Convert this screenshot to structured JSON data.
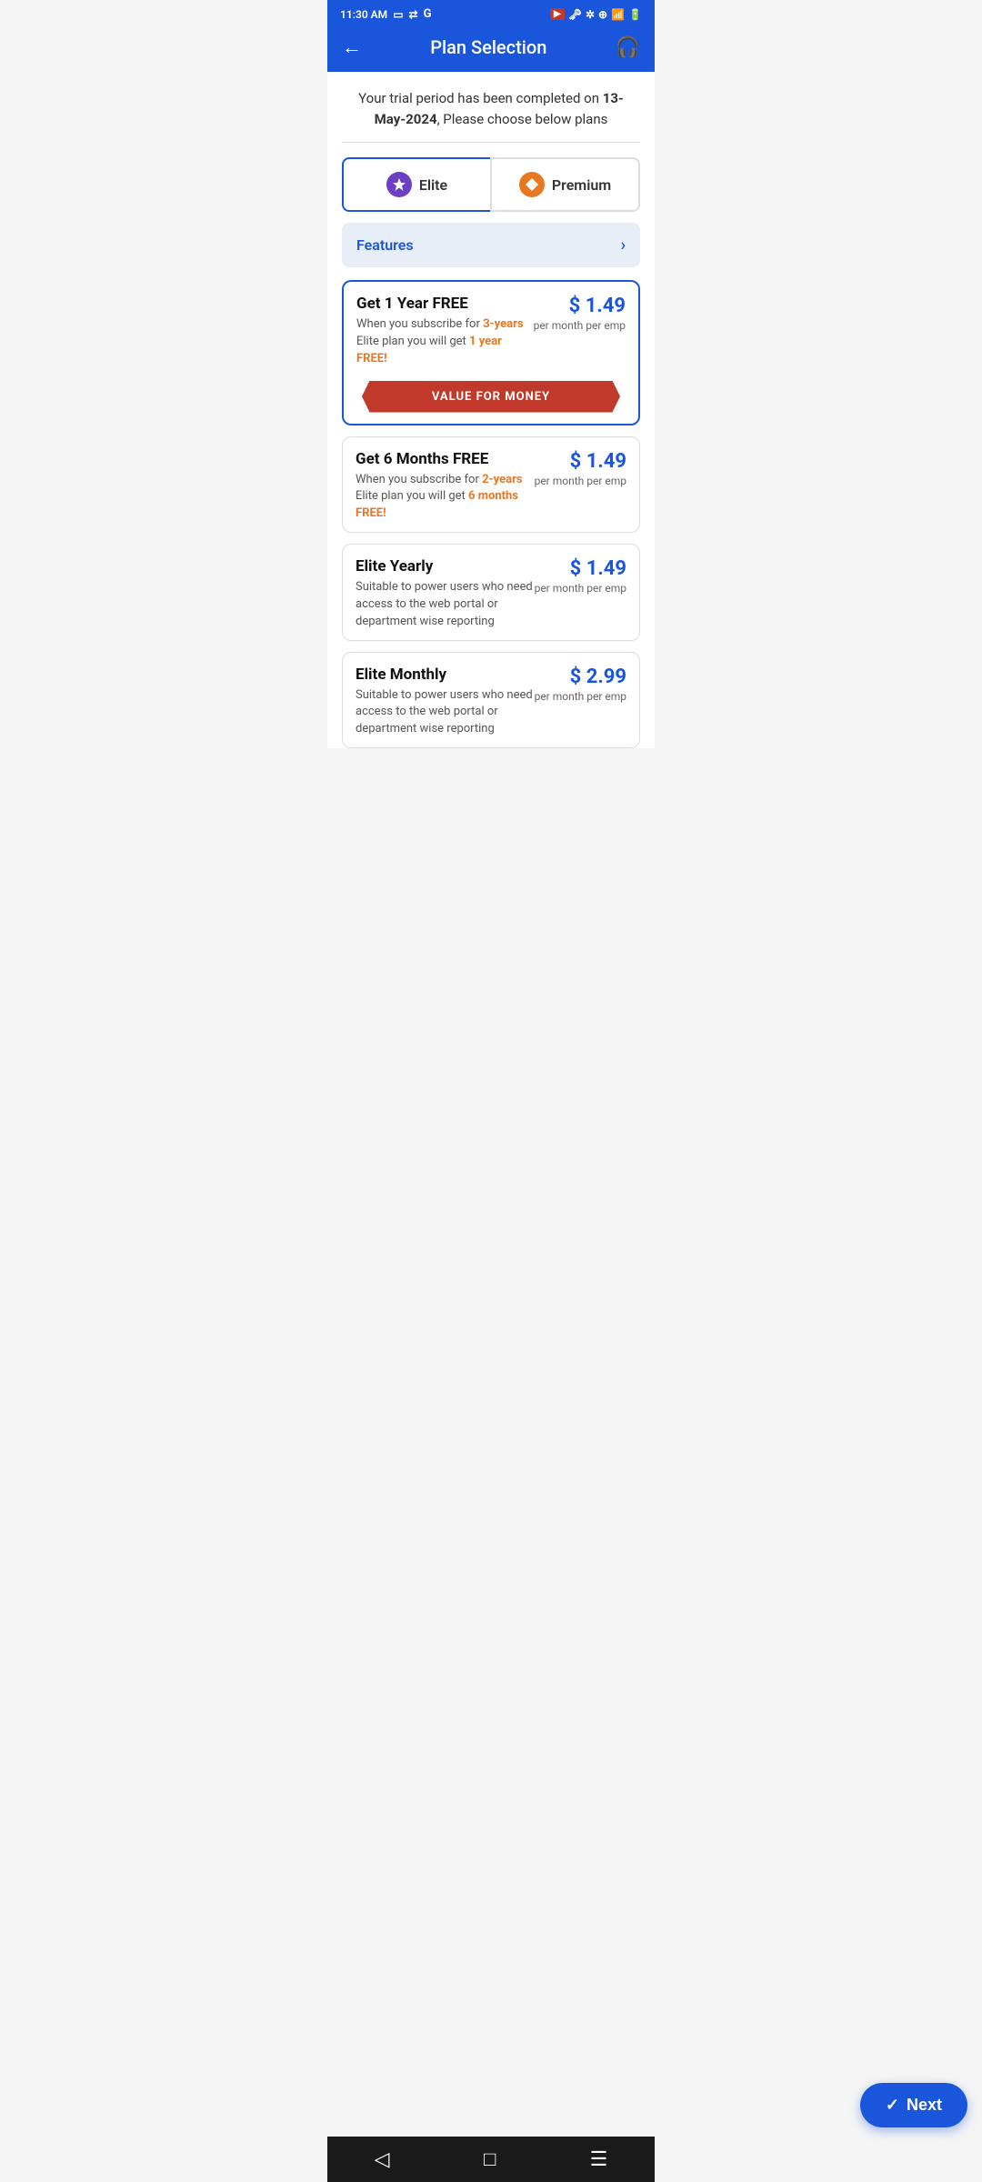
{
  "statusBar": {
    "time": "11:30 AM"
  },
  "header": {
    "title": "Plan Selection",
    "backLabel": "←",
    "supportLabel": "🎧"
  },
  "trialNotice": {
    "prefix": "Your trial period has been completed on ",
    "date": "13-May-2024",
    "suffix": ", Please choose below plans"
  },
  "planTabs": [
    {
      "id": "elite",
      "label": "Elite",
      "active": true
    },
    {
      "id": "premium",
      "label": "Premium",
      "active": false
    }
  ],
  "featuresRow": {
    "label": "Features",
    "arrow": "›"
  },
  "planCards": [
    {
      "id": "plan-1year",
      "selected": true,
      "title": "Get 1 Year FREE",
      "desc_prefix": "When you subscribe for ",
      "desc_highlight1": "3-years",
      "desc_middle": " Elite plan you will get ",
      "desc_highlight2": "1 year FREE!",
      "price": "$ 1.49",
      "priceSub": "per month per emp",
      "banner": "VALUE FOR MONEY"
    },
    {
      "id": "plan-6months",
      "selected": false,
      "title": "Get 6 Months FREE",
      "desc_prefix": "When you subscribe for ",
      "desc_highlight1": "2-years",
      "desc_middle": " Elite plan you will get ",
      "desc_highlight2": "6 months FREE!",
      "price": "$ 1.49",
      "priceSub": "per month per emp",
      "banner": null
    },
    {
      "id": "plan-yearly",
      "selected": false,
      "title": "Elite Yearly",
      "desc_prefix": "Suitable to power users who need access to the web portal or department wise reporting",
      "desc_highlight1": null,
      "desc_middle": null,
      "desc_highlight2": null,
      "price": "$ 1.49",
      "priceSub": "per month per emp",
      "banner": null
    },
    {
      "id": "plan-monthly",
      "selected": false,
      "title": "Elite Monthly",
      "desc_prefix": "Suitable to power users who need access to the web portal or department wise reporting",
      "desc_highlight1": null,
      "desc_middle": null,
      "desc_highlight2": null,
      "price": "$ 2.99",
      "priceSub": "per month per emp",
      "banner": null
    }
  ],
  "nextButton": {
    "label": "Next",
    "icon": "✓"
  },
  "bottomNav": [
    {
      "id": "back",
      "icon": "◁"
    },
    {
      "id": "home",
      "icon": "□"
    },
    {
      "id": "menu",
      "icon": "☰"
    }
  ]
}
